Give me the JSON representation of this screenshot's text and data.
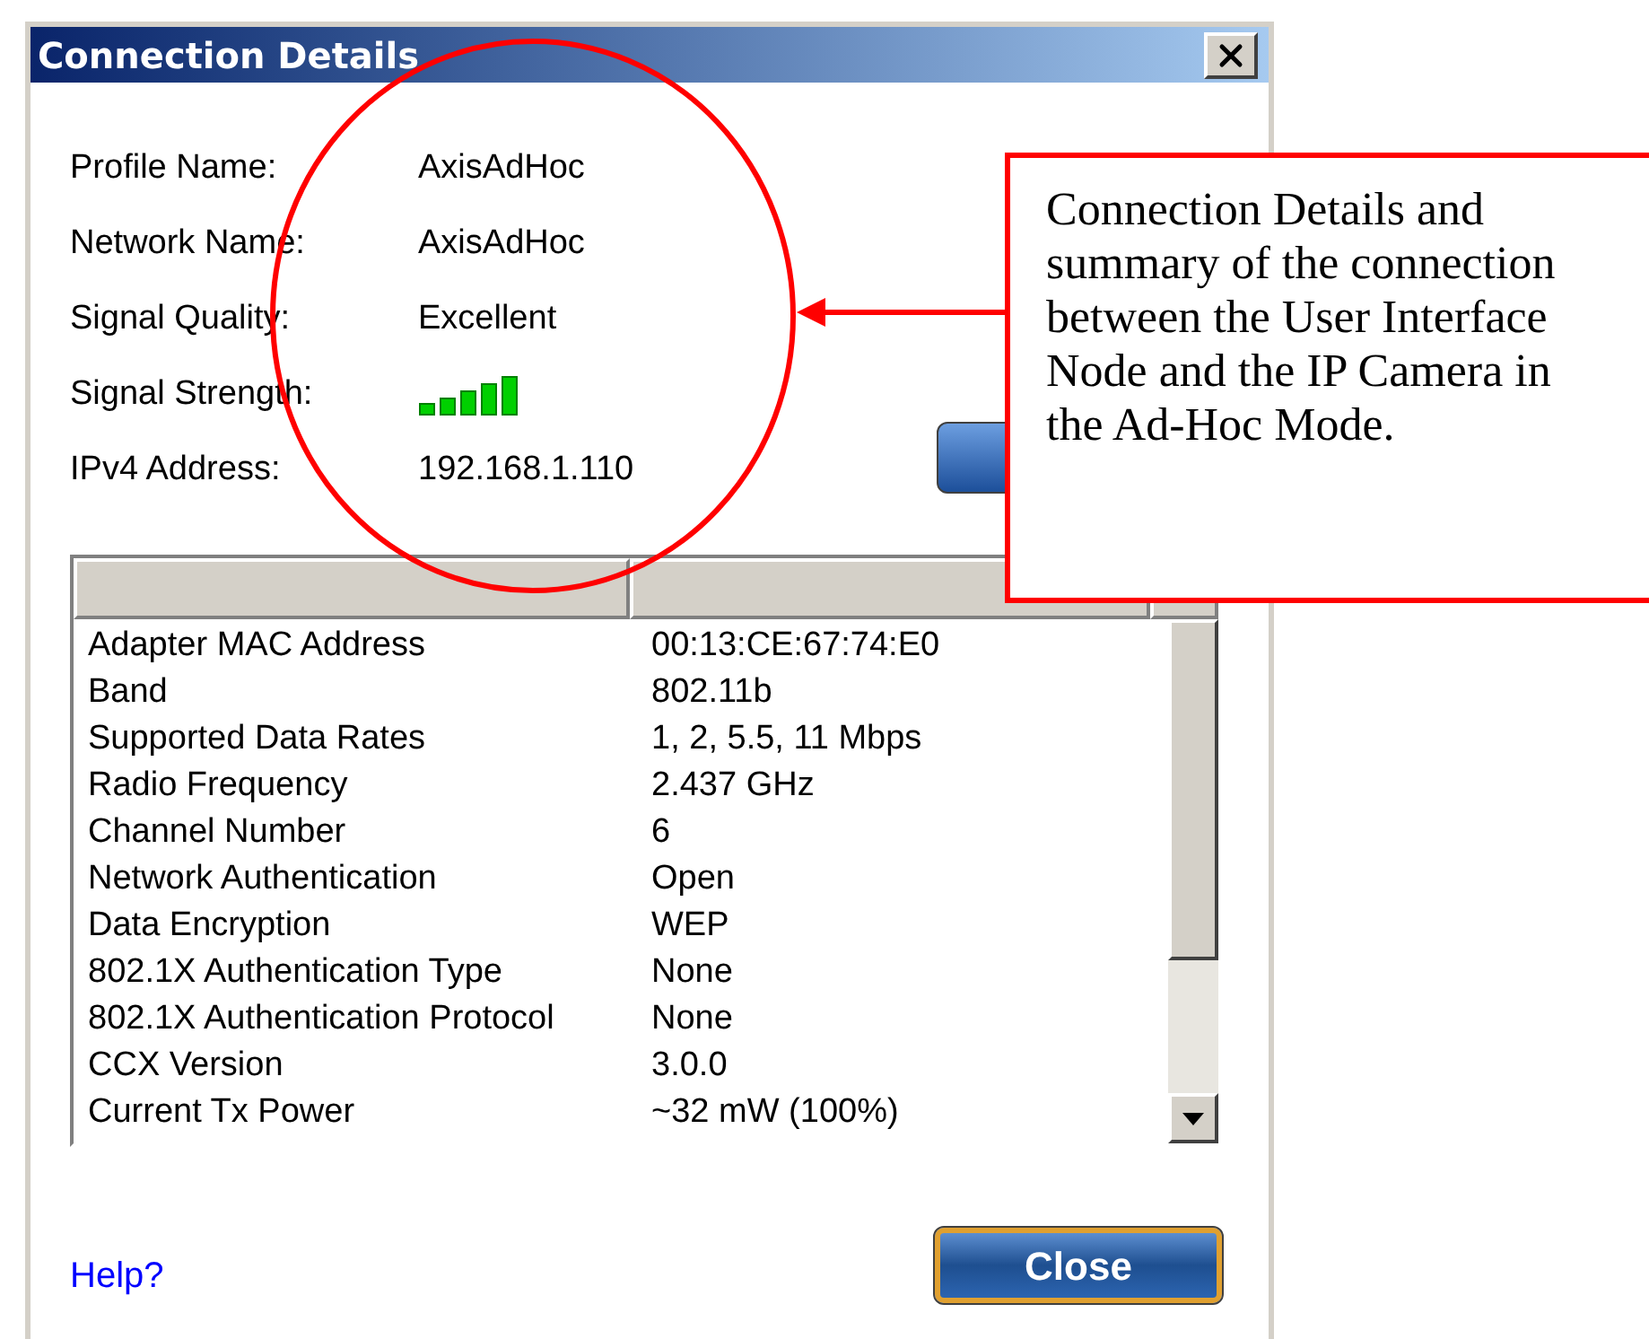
{
  "window": {
    "title": "Connection Details"
  },
  "summary": [
    {
      "kind": "text",
      "label": "Profile Name:",
      "value": "AxisAdHoc"
    },
    {
      "kind": "text",
      "label": "Network Name:",
      "value": "AxisAdHoc"
    },
    {
      "kind": "text",
      "label": "Signal Quality:",
      "value": "Excellent"
    },
    {
      "kind": "signal",
      "label": "Signal Strength:"
    },
    {
      "kind": "text",
      "label": "IPv4 Address:",
      "value": "192.168.1.110"
    }
  ],
  "details": {
    "rows": [
      {
        "name": "Adapter MAC Address",
        "value": "00:13:CE:67:74:E0"
      },
      {
        "name": "Band",
        "value": "802.11b"
      },
      {
        "name": "Supported Data Rates",
        "value": "1, 2, 5.5, 11 Mbps"
      },
      {
        "name": "Radio Frequency",
        "value": "2.437 GHz"
      },
      {
        "name": "Channel Number",
        "value": "6"
      },
      {
        "name": "Network Authentication",
        "value": "Open"
      },
      {
        "name": "Data Encryption",
        "value": "WEP"
      },
      {
        "name": "802.1X Authentication Type",
        "value": "None"
      },
      {
        "name": "802.1X Authentication Protocol",
        "value": "None"
      },
      {
        "name": "CCX Version",
        "value": "3.0.0"
      },
      {
        "name": "Current Tx Power",
        "value": "~32 mW (100%)"
      }
    ]
  },
  "help_link": "Help?",
  "close_button": "Close",
  "annotation": {
    "text": "Connection Details and summary of the connection between the User Interface Node and the IP Camera in the Ad-Hoc Mode."
  }
}
